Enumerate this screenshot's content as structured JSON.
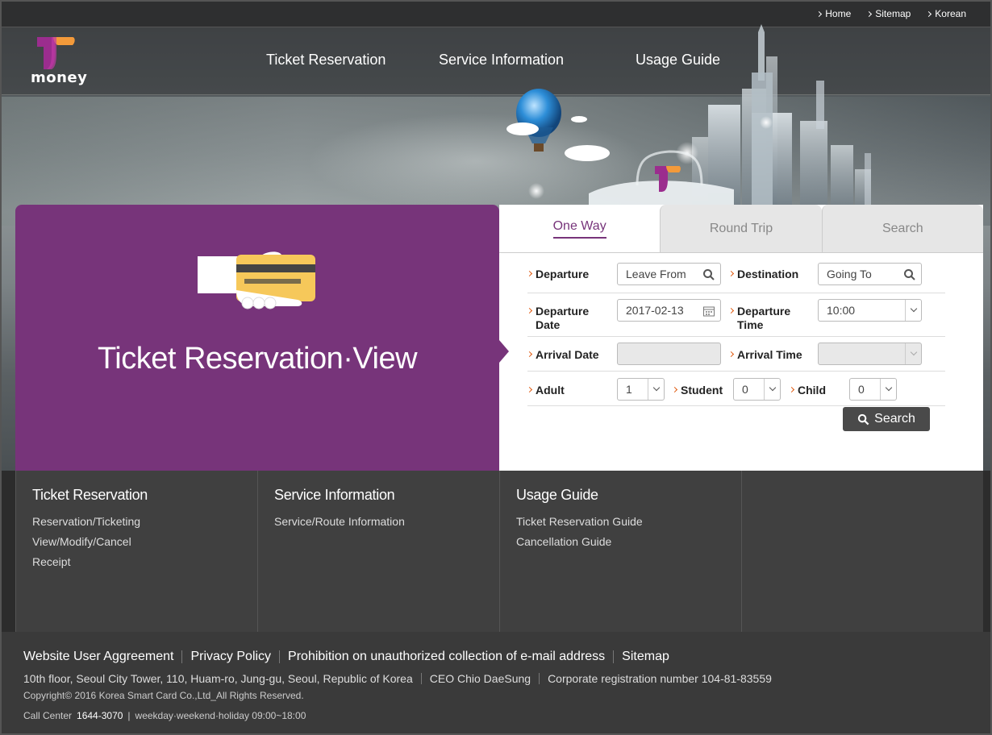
{
  "util_links": [
    "Home",
    "Sitemap",
    "Korean"
  ],
  "logo": {
    "text": "money"
  },
  "nav": [
    "Ticket Reservation",
    "Service Information",
    "Usage Guide"
  ],
  "hero": {
    "title": "Ticket Reservation·View"
  },
  "tabs": [
    "One Way",
    "Round Trip",
    "Search"
  ],
  "form": {
    "departure_label": "Departure",
    "departure_placeholder": "Leave From",
    "destination_label": "Destination",
    "destination_placeholder": "Going To",
    "departure_date_label": "Departure Date",
    "departure_date_value": "2017-02-13",
    "departure_time_label": "Departure Time",
    "departure_time_value": "10:00",
    "arrival_date_label": "Arrival Date",
    "arrival_time_label": "Arrival Time",
    "adult_label": "Adult",
    "adult_value": "1",
    "student_label": "Student",
    "student_value": "0",
    "child_label": "Child",
    "child_value": "0",
    "search_button": "Search"
  },
  "menu": [
    {
      "title": "Ticket Reservation",
      "links": [
        "Reservation/Ticketing",
        "View/Modify/Cancel",
        "Receipt"
      ]
    },
    {
      "title": "Service Information",
      "links": [
        "Service/Route Information"
      ]
    },
    {
      "title": "Usage Guide",
      "links": [
        "Ticket Reservation Guide",
        "Cancellation Guide"
      ]
    }
  ],
  "footer": {
    "links": [
      "Website User Aggreement",
      "Privacy Policy",
      "Prohibition on unauthorized collection of e-mail address",
      "Sitemap"
    ],
    "address": "10th floor, Seoul City Tower, 110, Huam-ro, Jung-gu, Seoul, Republic of Korea",
    "ceo": "CEO Chio DaeSung",
    "corp_reg": "Corporate registration number 104-81-83559",
    "copyright": "Copyright© 2016 Korea Smart Card Co.,Ltd_All Rights Reserved.",
    "call_center_label": "Call Center",
    "call_center_number": "1644-3070",
    "hours": "weekday·weekend·holiday 09:00~18:00"
  },
  "colors": {
    "brand_purple": "#77347a",
    "accent_orange": "#e05b10",
    "logo_orange": "#f39a3a"
  }
}
